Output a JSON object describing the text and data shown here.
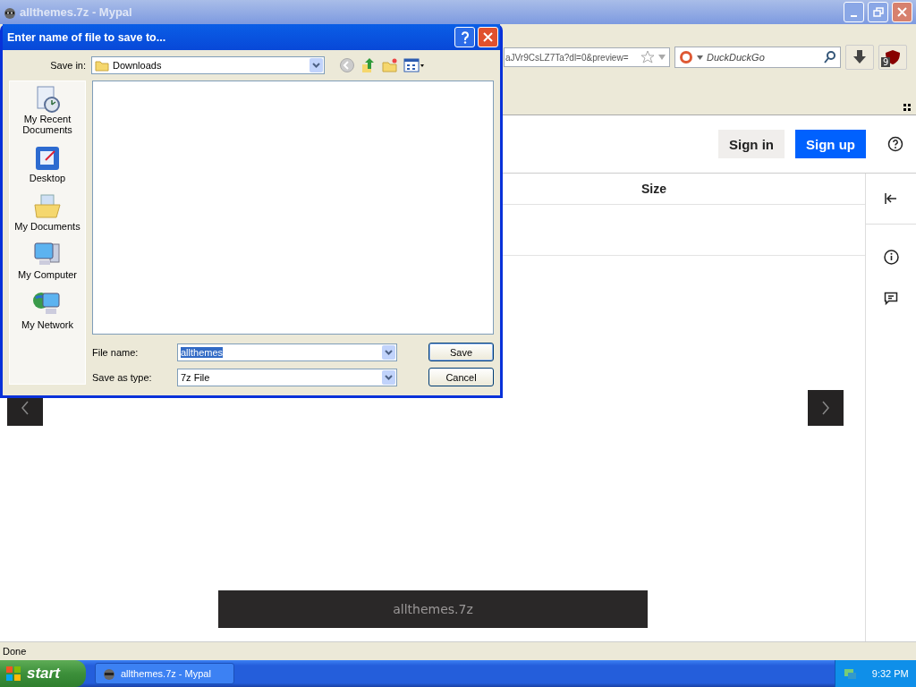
{
  "browser": {
    "title": "allthemes.7z - Mypal",
    "address": "aJVr9CsLZ7Ta?dl=0&preview=",
    "search_placeholder": "DuckDuckGo",
    "addon_badge": "9"
  },
  "page": {
    "buttons": [
      {
        "label": "Sign in",
        "kind": "secondary"
      },
      {
        "label": "Sign up",
        "kind": "primary"
      }
    ],
    "table": {
      "columns": [
        "Size"
      ]
    },
    "file_bar": "allthemes.7z"
  },
  "status_bar": "Done",
  "taskbar": {
    "start": "start",
    "tasks": [
      {
        "label": "allthemes.7z - Mypal",
        "selected": false
      }
    ],
    "clock": "9:32 PM"
  },
  "dialog": {
    "title": "Enter name of file to save to...",
    "save_in_label": "Save in:",
    "save_in": "Downloads",
    "places": [
      {
        "label": "My Recent Documents",
        "kind": "recent"
      },
      {
        "label": "Desktop",
        "kind": "desktop"
      },
      {
        "label": "My Documents",
        "kind": "documents"
      },
      {
        "label": "My Computer",
        "kind": "computer"
      },
      {
        "label": "My Network",
        "kind": "network"
      }
    ],
    "file_name_label": "File name:",
    "file_name": {
      "value": "allthemes",
      "highlighted": true
    },
    "type_label": "Save as type:",
    "type": "7z File",
    "buttons": [
      {
        "label": "Save",
        "kind": "default"
      },
      {
        "label": "Cancel",
        "kind": "normal"
      }
    ]
  }
}
